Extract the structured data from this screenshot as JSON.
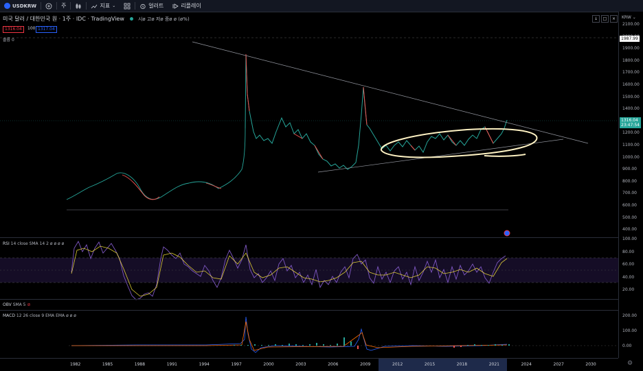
{
  "topbar": {
    "symbol": "USDKRW",
    "add_label": "+",
    "interval": "주",
    "indicators_label": "지표",
    "layout_label": "",
    "alert_label": "얼러트",
    "replay_label": "리플레이"
  },
  "legend": {
    "title": "미국 달러 / 대한민국 원 · 1주 · IDC · TradingView",
    "ohlc": "시ø 고ø 저ø 종ø ø (ø%)"
  },
  "price_boxes": {
    "sell": "1316.04",
    "qty": "100",
    "buy": "1317.04"
  },
  "volume_label": "졸륨",
  "volume_value": "0",
  "currency": "KRW",
  "price_axis": [
    "2100.00",
    "2000.00",
    "1900.00",
    "1800.00",
    "1700.00",
    "1600.00",
    "1500.00",
    "1400.00",
    "1300.00",
    "1200.00",
    "1100.00",
    "1000.00",
    "900.00",
    "800.00",
    "700.00",
    "600.00",
    "500.00",
    "400.00"
  ],
  "high_tag": "1987.99",
  "last_price": "1316.04",
  "countdown": "23:47:54",
  "rsi": {
    "name": "RSI",
    "params": "14 close SMA 14 2",
    "values": "ø ø ø ø",
    "axis": [
      "100.00",
      "80.00",
      "60.00",
      "40.00",
      "20.00"
    ]
  },
  "obv": {
    "name": "OBV",
    "params": "SMA 5"
  },
  "macd": {
    "name": "MACD",
    "params": "12 26 close 9 EMA EMA",
    "values": "ø ø ø",
    "axis": [
      "200.00",
      "100.00",
      "0.00"
    ]
  },
  "time_axis": [
    "1982",
    "1985",
    "1988",
    "1991",
    "1994",
    "1997",
    "2000",
    "2003",
    "2006",
    "2009",
    "2012",
    "2015",
    "2018",
    "2021",
    "2024",
    "2027",
    "2030"
  ],
  "colors": {
    "up": "#26a69a",
    "down": "#ef5350",
    "rsi": "#7e57c2",
    "signal": "#ffeb3b",
    "ellipse": "#fff3c4"
  }
}
